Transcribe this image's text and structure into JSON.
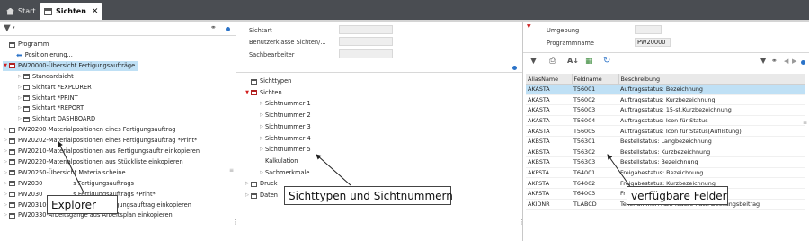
{
  "tabs": [
    {
      "label": "Start",
      "icon": "home-icon"
    },
    {
      "label": "Sichten",
      "icon": "window-icon",
      "close": "✕"
    }
  ],
  "explorer": {
    "toolbar": {
      "filter_icon": "filter-icon",
      "binoculars_icon": "binoculars-icon"
    },
    "items": [
      {
        "label": "Programm",
        "indent": 0,
        "toggle": "",
        "icon": "node"
      },
      {
        "label": "Positionierung...",
        "indent": 1,
        "toggle": "",
        "icon": "arrow-left"
      },
      {
        "label": "PW20000-Übersicht Fertigungsaufträge",
        "indent": 0,
        "toggle": "open",
        "icon": "node-red",
        "selected": true
      },
      {
        "label": "Standardsicht",
        "indent": 2,
        "toggle": "closed",
        "icon": "node"
      },
      {
        "label": "Sichtart *EXPLORER",
        "indent": 2,
        "toggle": "closed",
        "icon": "node"
      },
      {
        "label": "Sichtart *PRINT",
        "indent": 2,
        "toggle": "closed",
        "icon": "node"
      },
      {
        "label": "Sichtart *REPORT",
        "indent": 2,
        "toggle": "closed",
        "icon": "node"
      },
      {
        "label": "Sichtart DASHBOARD",
        "indent": 2,
        "toggle": "closed",
        "icon": "node"
      },
      {
        "label": "PW20200-Materialpositionen eines Fertigungsauftrag",
        "indent": 0,
        "toggle": "closed",
        "icon": "node"
      },
      {
        "label": "PW20202-Materialpositionen eines Fertigungsauftrag *Print*",
        "indent": 0,
        "toggle": "closed",
        "icon": "node"
      },
      {
        "label": "PW20210-Materialpositionen aus Fertigungsauftr einkopieren",
        "indent": 0,
        "toggle": "closed",
        "icon": "node"
      },
      {
        "label": "PW20220-Materialpositionen aus Stückliste einkopieren",
        "indent": 0,
        "toggle": "closed",
        "icon": "node"
      },
      {
        "label": "PW20250-Übersicht Materialscheine",
        "indent": 0,
        "toggle": "closed",
        "icon": "node"
      },
      {
        "label": "PW2030",
        "suffix": "s Fertigungsauftrags",
        "indent": 0,
        "toggle": "closed",
        "icon": "node"
      },
      {
        "label": "PW2030",
        "suffix": "s Fertigungsauftrags *Print*",
        "indent": 0,
        "toggle": "closed",
        "icon": "node"
      },
      {
        "label": "PW20310-Arbeitsgänge aus Fertigungsauftrag einkopieren",
        "indent": 0,
        "toggle": "closed",
        "icon": "node"
      },
      {
        "label": "PW20330-Arbeitsgänge aus Arbeitsplan einkopieren",
        "indent": 0,
        "toggle": "closed",
        "icon": "node"
      }
    ]
  },
  "middle": {
    "fields": [
      {
        "label": "Sichtart",
        "value": ""
      },
      {
        "label": "Benutzerklasse Sichten/...",
        "value": ""
      },
      {
        "label": "Sachbearbeiter",
        "value": ""
      }
    ],
    "tree": [
      {
        "label": "Sichttypen",
        "indent": 0,
        "toggle": "",
        "icon": "node"
      },
      {
        "label": "Sichten",
        "indent": 0,
        "toggle": "open",
        "icon": "node-red"
      },
      {
        "label": "Sichtnummer 1",
        "indent": 2,
        "toggle": "closed",
        "icon": ""
      },
      {
        "label": "Sichtnummer 2",
        "indent": 2,
        "toggle": "closed",
        "icon": ""
      },
      {
        "label": "Sichtnummer 3",
        "indent": 2,
        "toggle": "closed",
        "icon": ""
      },
      {
        "label": "Sichtnummer 4",
        "indent": 2,
        "toggle": "closed",
        "icon": ""
      },
      {
        "label": "Sichtnummer 5",
        "indent": 2,
        "toggle": "closed",
        "icon": ""
      },
      {
        "label": "Kalkulation",
        "indent": 2,
        "toggle": "",
        "icon": ""
      },
      {
        "label": "Sachmerkmale",
        "indent": 2,
        "toggle": "closed",
        "icon": ""
      },
      {
        "label": "Druck",
        "indent": 0,
        "toggle": "closed",
        "icon": "node"
      },
      {
        "label": "Daten",
        "indent": 0,
        "toggle": "closed",
        "icon": "node"
      }
    ]
  },
  "right": {
    "fields": [
      {
        "label": "Umgebung",
        "value": ""
      },
      {
        "label": "Programmname",
        "value": "PW20000"
      }
    ],
    "grid": {
      "columns": [
        "AliasName",
        "Feldname",
        "Beschreibung"
      ],
      "rows": [
        [
          "AKASTA",
          "T56001",
          "Auftragsstatus: Bezeichnung"
        ],
        [
          "AKASTA",
          "T56002",
          "Auftragsstatus: Kurzbezeichnung"
        ],
        [
          "AKASTA",
          "T56003",
          "Auftragsstatus: 15-st.Kurzbezeichnung"
        ],
        [
          "AKASTA",
          "T56004",
          "Auftragsstatus: Icon für Status"
        ],
        [
          "AKASTA",
          "T56005",
          "Auftragsstatus: Icon für Status(Auflistung)"
        ],
        [
          "AKBSTA",
          "T56301",
          "Bestellstatus: Langbezeichnung"
        ],
        [
          "AKBSTA",
          "T56302",
          "Bestellstatus: Kurzbezeichnung"
        ],
        [
          "AKBSTA",
          "T56303",
          "Bestellstatus: Bezeichnung"
        ],
        [
          "AKFSTA",
          "T64001",
          "Freigabestatus: Bezeichnung"
        ],
        [
          "AKFSTA",
          "T64002",
          "Freigabestatus: Kurzbezeichnung"
        ],
        [
          "AKFSTA",
          "T64003",
          "Fr"
        ],
        [
          "AKIDNR",
          "TLABCD",
          "Teilenummer: ABC-Klasse nach Deckungsbeitrag"
        ]
      ]
    }
  },
  "callouts": {
    "explorer": "Explorer",
    "types": "Sichttypen und Sichtnummern",
    "fields": "verfügbare Felder"
  }
}
